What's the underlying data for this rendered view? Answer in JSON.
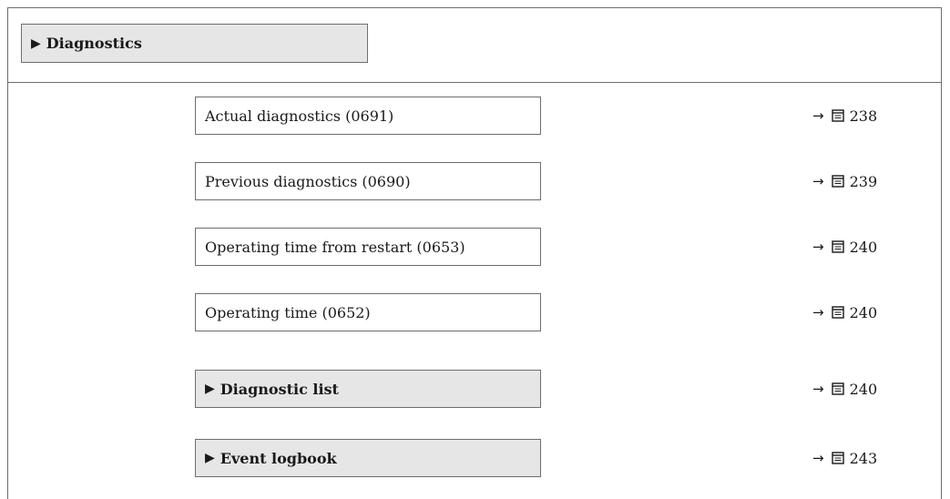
{
  "header": {
    "marker": "▶",
    "title": "Diagnostics"
  },
  "rows": [
    {
      "label": "Actual diagnostics (0691)",
      "arrow": "→",
      "page": "238",
      "submenu": false
    },
    {
      "label": "Previous diagnostics (0690)",
      "arrow": "→",
      "page": "239",
      "submenu": false
    },
    {
      "label": "Operating time from restart (0653)",
      "arrow": "→",
      "page": "240",
      "submenu": false
    },
    {
      "label": "Operating time (0652)",
      "arrow": "→",
      "page": "240",
      "submenu": false
    },
    {
      "label": "Diagnostic list",
      "marker": "▶",
      "arrow": "→",
      "page": "240",
      "submenu": true
    },
    {
      "label": "Event logbook",
      "marker": "▶",
      "arrow": "→",
      "page": "243",
      "submenu": true
    }
  ],
  "colors": {
    "border": "#6e6e6e",
    "submenu_fill": "#e6e6e6",
    "text": "#1a1a1a"
  },
  "icons": {
    "page_ref": "book-icon",
    "submenu": "triangle-right-icon"
  }
}
